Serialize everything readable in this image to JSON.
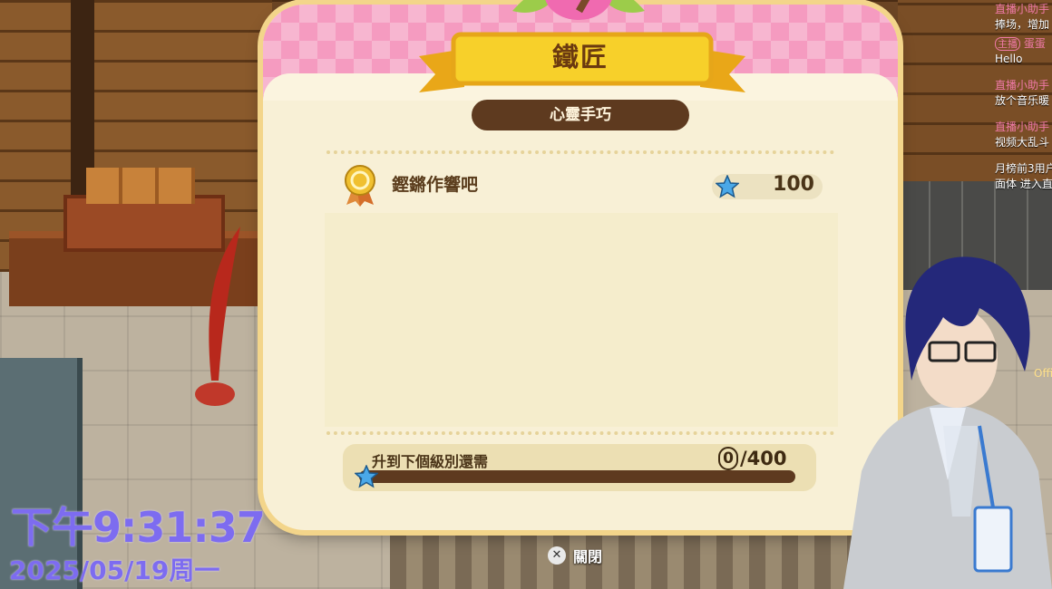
{
  "dialog": {
    "title": "鐵匠",
    "subtitle": "心靈手巧",
    "reward_row": {
      "label": "鏗鏘作響吧",
      "points": "100"
    },
    "progress": {
      "label": "升到下個級別還需",
      "current": "0",
      "total": "/400",
      "fraction": 0.0
    },
    "close_label": "關閉",
    "close_button_icon": "cross-icon"
  },
  "overlay": {
    "clock_time": "下午9:31:37",
    "clock_date": "2025/05/19周一"
  },
  "chat": {
    "messages": [
      {
        "user": "直播小助手",
        "text": "捧场，增加"
      },
      {
        "host_tag": "主播",
        "user": "蛋蛋",
        "text": "Hello"
      },
      {
        "user": "直播小助手",
        "text": "放个音乐暖"
      },
      {
        "user": "直播小助手",
        "text": "视频大乱斗"
      },
      {
        "user": "",
        "text": "月榜前3用户"
      },
      {
        "user": "",
        "text": "面体 进入直"
      }
    ],
    "corner_text": "Offi"
  },
  "colors": {
    "title_brown": "#6b3a10",
    "pill_brown": "#5e3a1f",
    "panel_cream": "#f8f0d6",
    "pink_pattern": "#f7b6d0",
    "clock_purple": "#7d6cf0",
    "star_blue": "#4aa8e8",
    "medal_gold": "#f0c030"
  }
}
